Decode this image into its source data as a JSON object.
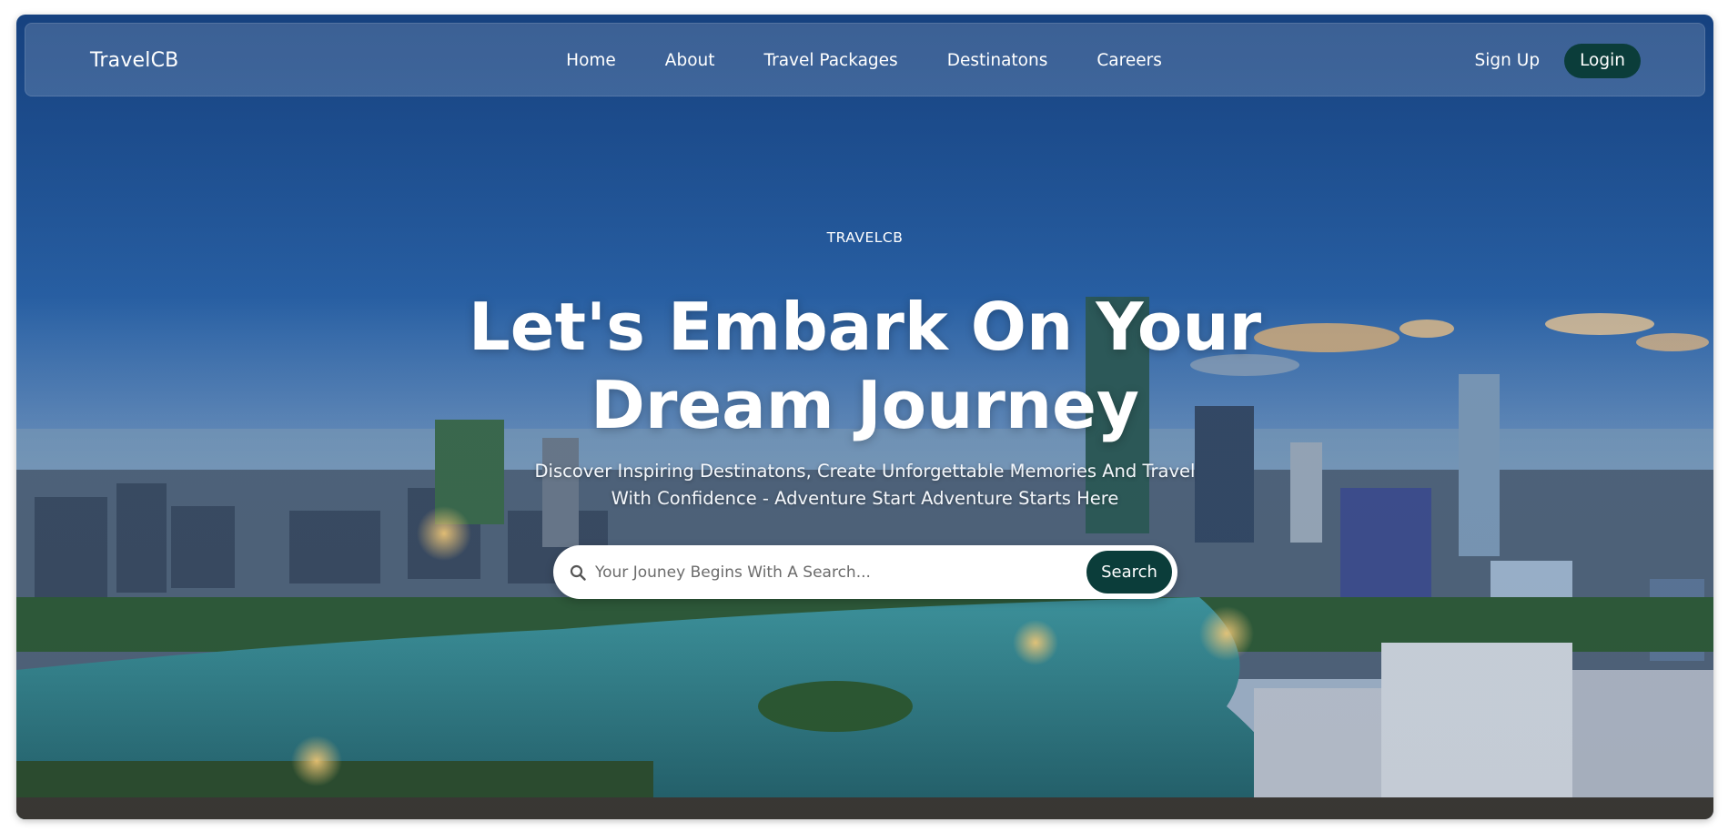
{
  "navbar": {
    "brand": "TravelCB",
    "links": [
      {
        "label": "Home"
      },
      {
        "label": "About"
      },
      {
        "label": "Travel Packages"
      },
      {
        "label": "Destinatons"
      },
      {
        "label": "Careers"
      }
    ],
    "signup_label": "Sign Up",
    "login_label": "Login"
  },
  "hero": {
    "eyebrow": "TRAVELCB",
    "headline_line1": "Let's Embark On Your",
    "headline_line2": "Dream Journey",
    "subtext": "Discover Inspiring Destinatons, Create Unforgettable Memories And Travel With Confidence - Adventure Start Adventure Starts Here",
    "background_image": "city skyline at dusk with lake"
  },
  "search": {
    "placeholder": "Your Jouney Begins With A Search...",
    "value": "",
    "button_label": "Search",
    "icon": "search-icon"
  },
  "colors": {
    "accent": "#0b3d3a",
    "nav_bg": "rgba(255,255,255,0.16)",
    "sky_top": "#1d4f8f",
    "water": "#2f8a8e"
  }
}
